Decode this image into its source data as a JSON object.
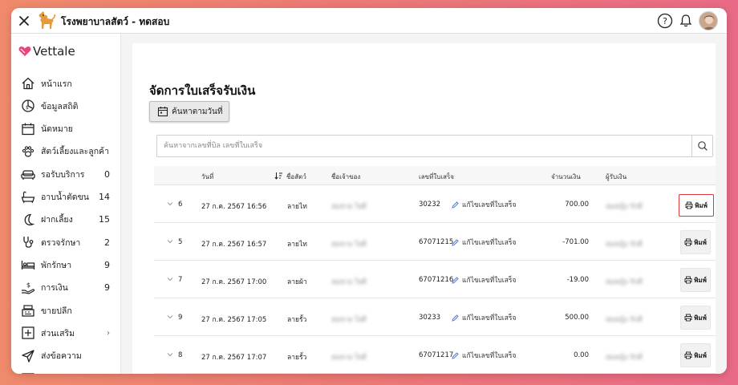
{
  "header": {
    "title": "โรงพยาบาลสัตว์ - ทดสอบ"
  },
  "brand": {
    "name": "Vettale",
    "accent": "#e8457a"
  },
  "sidebar": {
    "items": [
      {
        "label": "หน้าแรก",
        "icon": "home-icon",
        "count": ""
      },
      {
        "label": "ข้อมูลสถิติ",
        "icon": "stats-icon",
        "count": ""
      },
      {
        "label": "นัดหมาย",
        "icon": "calendar-icon",
        "count": ""
      },
      {
        "label": "สัตว์เลี้ยงและลูกค้า",
        "icon": "paw-icon",
        "count": ""
      },
      {
        "label": "รอรับบริการ",
        "icon": "couch-icon",
        "count": "0"
      },
      {
        "label": "อาบน้ำตัดขน",
        "icon": "bathtub-icon",
        "count": "14"
      },
      {
        "label": "ฝากเลี้ยง",
        "icon": "moon-icon",
        "count": "15"
      },
      {
        "label": "ตรวจรักษา",
        "icon": "stethoscope-icon",
        "count": "2"
      },
      {
        "label": "พักรักษา",
        "icon": "bed-icon",
        "count": "9"
      },
      {
        "label": "การเงิน",
        "icon": "money-hand-icon",
        "count": "9"
      },
      {
        "label": "ขายปลีก",
        "icon": "register-icon",
        "count": ""
      },
      {
        "label": "ส่วนเสริม",
        "icon": "plus-square-icon",
        "count": "",
        "chevron": "›"
      },
      {
        "label": "ส่งข้อความ",
        "icon": "send-icon",
        "count": ""
      },
      {
        "label": "คลัง",
        "icon": "box-icon",
        "count": ""
      }
    ]
  },
  "main": {
    "title": "จัดการใบเสร็จรับเงิน",
    "date_search_label": "ค้นหาตามวันที่",
    "search_placeholder": "ค้นหาจากเลขที่บิล เลขที่ใบเสร็จ"
  },
  "table": {
    "headers": {
      "date": "วันที่",
      "pet": "ชื่อสัตว์",
      "owner": "ชื่อเจ้าของ",
      "receipt": "เลขที่ใบเสร็จ",
      "amount": "จำนวนเงิน",
      "receiver": "ผู้รับเงิน"
    },
    "edit_label": "แก้ไขเลขที่ใบเสร็จ",
    "print_label": "พิมพ์",
    "rows": [
      {
        "no": "6",
        "date": "27 ก.ค. 2567 16:56",
        "pet": "ลายไท",
        "owner": "สมชาย ใจดี",
        "receipt": "30232",
        "amount": "700.00",
        "receiver": "สมหญิง รักดี",
        "highlight": true
      },
      {
        "no": "5",
        "date": "27 ก.ค. 2567 16:57",
        "pet": "ลายไท",
        "owner": "สมชาย ใจดี",
        "receipt": "67071215",
        "amount": "-701.00",
        "receiver": "สมหญิง รักดี",
        "highlight": false
      },
      {
        "no": "7",
        "date": "27 ก.ค. 2567 17:00",
        "pet": "ลายผ้า",
        "owner": "สมชาย ใจดี",
        "receipt": "67071216",
        "amount": "-19.00",
        "receiver": "สมหญิง รักดี",
        "highlight": false
      },
      {
        "no": "9",
        "date": "27 ก.ค. 2567 17:05",
        "pet": "ลายรั้ว",
        "owner": "สมชาย ใจดี",
        "receipt": "30233",
        "amount": "500.00",
        "receiver": "สมหญิง รักดี",
        "highlight": false
      },
      {
        "no": "8",
        "date": "27 ก.ค. 2567 17:07",
        "pet": "ลายรั้ว",
        "owner": "สมชาย ใจดี",
        "receipt": "67071217",
        "amount": "0.00",
        "receiver": "สมหญิง รักดี",
        "highlight": false
      }
    ]
  }
}
